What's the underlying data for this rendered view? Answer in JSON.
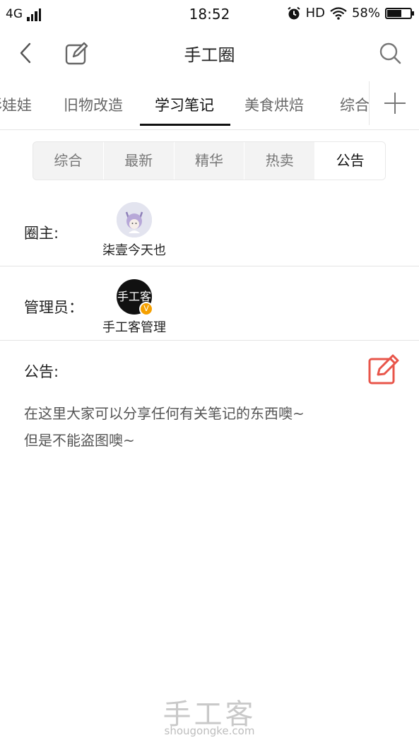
{
  "status_bar": {
    "network": "4G",
    "time": "18:52",
    "hd": "HD",
    "battery_text": "58%",
    "battery_level": 0.58
  },
  "nav": {
    "title": "手工圈",
    "icons": [
      "back-icon",
      "edit-icon",
      "search-icon"
    ]
  },
  "categories": {
    "items": [
      {
        "label": "彩娃娃",
        "active": false
      },
      {
        "label": "旧物改造",
        "active": false
      },
      {
        "label": "学习笔记",
        "active": true
      },
      {
        "label": "美食烘焙",
        "active": false
      },
      {
        "label": "综合",
        "active": false
      }
    ],
    "add_icon": "plus-icon"
  },
  "subtabs": {
    "items": [
      {
        "label": "综合",
        "active": false
      },
      {
        "label": "最新",
        "active": false
      },
      {
        "label": "精华",
        "active": false
      },
      {
        "label": "热卖",
        "active": false
      },
      {
        "label": "公告",
        "active": true
      }
    ]
  },
  "owner": {
    "label": "圈主:",
    "name": "柒壹今天也"
  },
  "admin": {
    "label": "管理员：",
    "name": "手工客管理",
    "avatar_text": "手工客",
    "badge": "V"
  },
  "notice": {
    "label": "公告:",
    "lines": [
      "在这里大家可以分享任何有关笔记的东西噢~",
      "但是不能盗图噢~"
    ],
    "edit_icon_color": "#e8554a"
  },
  "watermark": {
    "logo": "手工客",
    "url": "shougongke.com"
  }
}
